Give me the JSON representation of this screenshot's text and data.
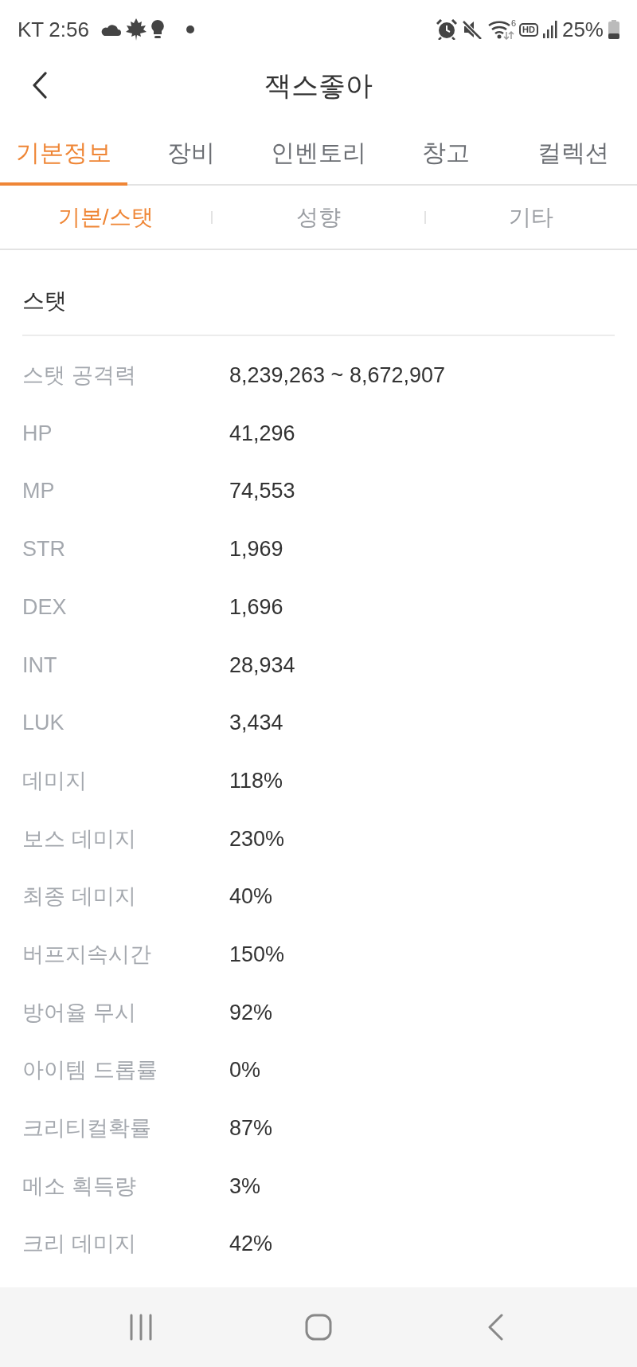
{
  "status_bar": {
    "carrier": "KT",
    "time": "2:56",
    "wifi_standard": "6",
    "hd_label": "HD",
    "battery": "25%"
  },
  "header": {
    "title": "잭스좋아"
  },
  "tabs": [
    {
      "label": "기본정보",
      "selected": true
    },
    {
      "label": "장비",
      "selected": false
    },
    {
      "label": "인벤토리",
      "selected": false
    },
    {
      "label": "창고",
      "selected": false
    },
    {
      "label": "컬렉션",
      "selected": false
    }
  ],
  "sub_tabs": [
    {
      "label": "기본/스탯",
      "selected": true
    },
    {
      "label": "성향",
      "selected": false
    },
    {
      "label": "기타",
      "selected": false
    }
  ],
  "section": {
    "title": "스탯",
    "rows": [
      {
        "label": "스탯 공격력",
        "value": "8,239,263 ~ 8,672,907"
      },
      {
        "label": "HP",
        "value": "41,296"
      },
      {
        "label": "MP",
        "value": "74,553"
      },
      {
        "label": "STR",
        "value": "1,969"
      },
      {
        "label": "DEX",
        "value": "1,696"
      },
      {
        "label": "INT",
        "value": "28,934"
      },
      {
        "label": "LUK",
        "value": "3,434"
      },
      {
        "label": "데미지",
        "value": "118%"
      },
      {
        "label": "보스 데미지",
        "value": "230%"
      },
      {
        "label": "최종 데미지",
        "value": "40%"
      },
      {
        "label": "버프지속시간",
        "value": "150%"
      },
      {
        "label": "방어율 무시",
        "value": "92%"
      },
      {
        "label": "아이템 드롭률",
        "value": "0%"
      },
      {
        "label": "크리티컬확률",
        "value": "87%"
      },
      {
        "label": "메소 획득량",
        "value": "3%"
      },
      {
        "label": "크리 데미지",
        "value": "42%"
      }
    ]
  }
}
